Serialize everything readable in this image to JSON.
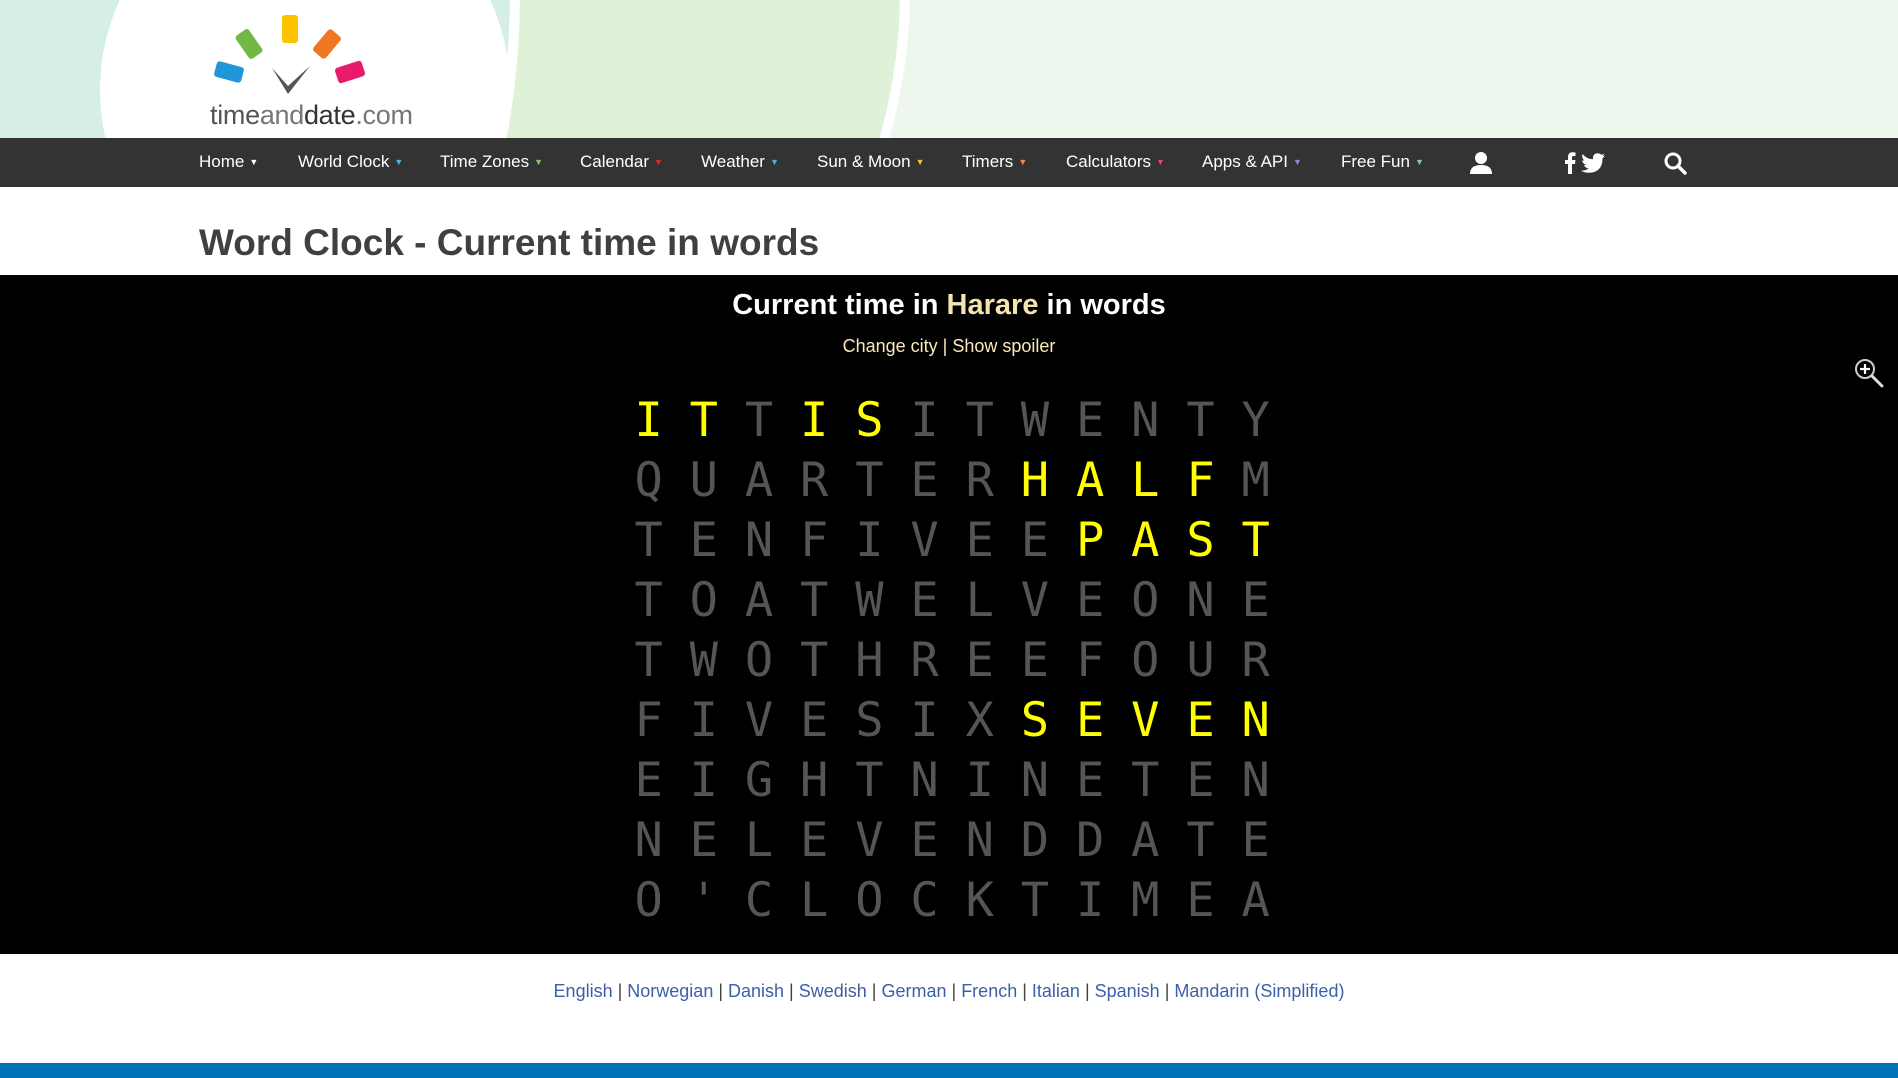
{
  "site": {
    "logo_text_a": "time",
    "logo_text_b": "and",
    "logo_text_c": "date",
    "logo_text_d": ".com"
  },
  "nav": {
    "items": [
      {
        "label": "Home",
        "caret_color": "#ffffff"
      },
      {
        "label": "World Clock",
        "caret_color": "#4fb3e8"
      },
      {
        "label": "Time Zones",
        "caret_color": "#8cc063"
      },
      {
        "label": "Calendar",
        "caret_color": "#e8262a"
      },
      {
        "label": "Weather",
        "caret_color": "#4fb3c8"
      },
      {
        "label": "Sun & Moon",
        "caret_color": "#f0c030"
      },
      {
        "label": "Timers",
        "caret_color": "#f08a4b"
      },
      {
        "label": "Calculators",
        "caret_color": "#e8407a"
      },
      {
        "label": "Apps & API",
        "caret_color": "#9b7fd4"
      },
      {
        "label": "Free Fun",
        "caret_color": "#8fc0a8"
      }
    ],
    "icons": [
      "user-icon",
      "facebook-icon",
      "twitter-icon",
      "search-icon"
    ]
  },
  "page": {
    "title": "Word Clock - Current time in words"
  },
  "clock": {
    "heading_prefix": "Current time in ",
    "city": "Harare",
    "heading_suffix": " in words",
    "change_city": "Change city",
    "separator": "|",
    "show_spoiler": "Show spoiler",
    "active_color": "#ffff00",
    "inactive_color": "#555555",
    "time_in_words": "IT IS HALF PAST SEVEN",
    "rows": [
      {
        "letters": "ITTISITWENTY",
        "lit": [
          0,
          1,
          3,
          4
        ]
      },
      {
        "letters": "QUARTERHALFM",
        "lit": [
          7,
          8,
          9,
          10
        ]
      },
      {
        "letters": "TENFIVEEPAST",
        "lit": [
          8,
          9,
          10,
          11
        ]
      },
      {
        "letters": "TOATWELVEONE",
        "lit": []
      },
      {
        "letters": "TWOTHREEFOUR",
        "lit": []
      },
      {
        "letters": "FIVESIXSEVEN",
        "lit": [
          7,
          8,
          9,
          10,
          11
        ]
      },
      {
        "letters": "EIGHTNINETEN",
        "lit": []
      },
      {
        "letters": "NELEVENDDATE",
        "lit": []
      },
      {
        "letters": "O'CLOCKTIMEA",
        "lit": []
      }
    ]
  },
  "languages": [
    "English",
    "Norwegian",
    "Danish",
    "Swedish",
    "German",
    "French",
    "Italian",
    "Spanish",
    "Mandarin (Simplified)"
  ]
}
